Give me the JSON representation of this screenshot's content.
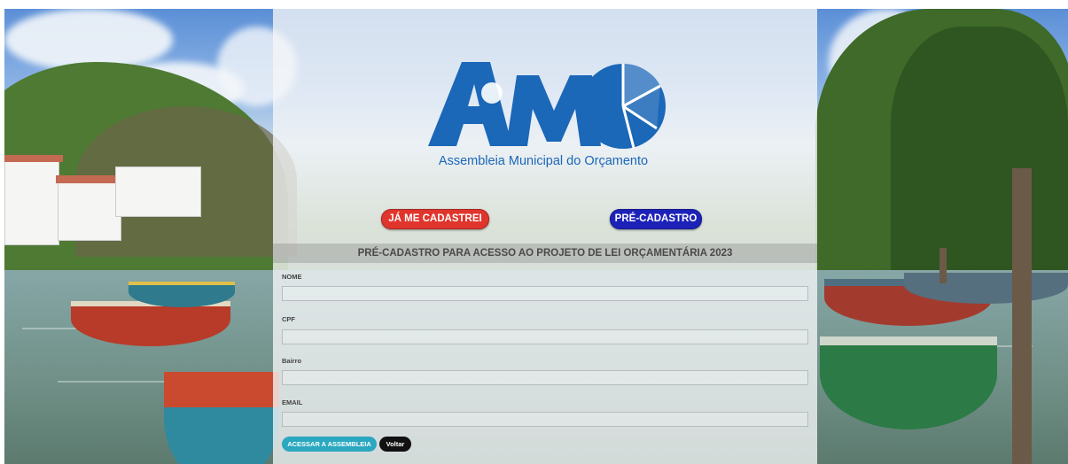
{
  "logo": {
    "wordmark": "AMO",
    "subtitle": "Assembleia Municipal do Orçamento",
    "brand_color": "#1b67b8"
  },
  "buttons": {
    "ja_me_cadastrei": "JÁ ME CADASTREI",
    "pre_cadastro": "PRÉ-CADASTRO"
  },
  "form": {
    "title": "PRÉ-CADASTRO PARA ACESSO AO PROJETO DE LEI ORÇAMENTÁRIA 2023",
    "fields": [
      {
        "label": "NOME",
        "value": ""
      },
      {
        "label": "CPF",
        "value": ""
      },
      {
        "label": "Bairro",
        "value": ""
      },
      {
        "label": "EMAIL",
        "value": ""
      }
    ],
    "submit_label": "ACESSAR A ASSEMBLEIA",
    "back_label": "Voltar"
  },
  "colors": {
    "ja_button": "#e0352c",
    "pre_button": "#1c22b8",
    "submit_button": "#2aa8bf",
    "back_button": "#111111"
  }
}
